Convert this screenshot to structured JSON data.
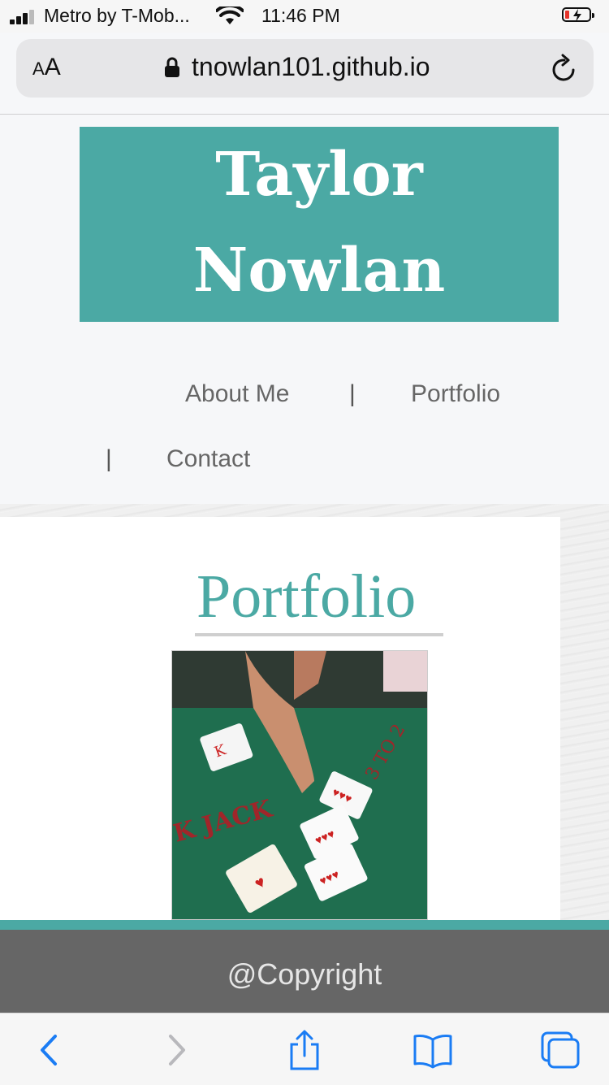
{
  "status_bar": {
    "carrier": "Metro by T-Mob...",
    "time": "11:46 PM"
  },
  "browser": {
    "text_size_label": "AA",
    "url": "tnowlan101.github.io"
  },
  "site": {
    "title_line1": "Taylor",
    "title_line2": "Nowlan",
    "nav": {
      "about": "About Me",
      "portfolio": "Portfolio",
      "contact": "Contact",
      "separator": "|"
    },
    "section_heading": "Portfolio",
    "footer_text": "@Copyright"
  },
  "colors": {
    "accent": "#4ba9a4",
    "footer_bg": "#666666",
    "link_blue": "#1a7cf4"
  },
  "icons": [
    "cellular-signal-icon",
    "wifi-icon",
    "battery-charging-icon",
    "lock-icon",
    "reload-icon",
    "back-icon",
    "forward-icon",
    "share-icon",
    "bookmarks-icon",
    "tabs-icon"
  ]
}
